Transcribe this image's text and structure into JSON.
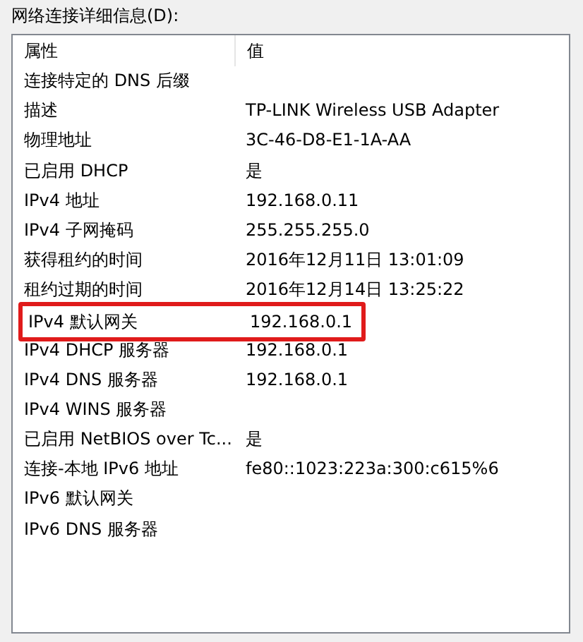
{
  "label": "网络连接详细信息(D):",
  "table": {
    "columns": [
      "属性",
      "值"
    ],
    "rows": [
      {
        "property": "连接特定的 DNS 后缀",
        "value": "",
        "highlighted": false
      },
      {
        "property": "描述",
        "value": "TP-LINK Wireless USB Adapter",
        "highlighted": false
      },
      {
        "property": "物理地址",
        "value": "3C-46-D8-E1-1A-AA",
        "highlighted": false
      },
      {
        "property": "已启用 DHCP",
        "value": "是",
        "highlighted": false
      },
      {
        "property": "IPv4 地址",
        "value": "192.168.0.11",
        "highlighted": false
      },
      {
        "property": "IPv4 子网掩码",
        "value": "255.255.255.0",
        "highlighted": false
      },
      {
        "property": "获得租约的时间",
        "value": "2016年12月11日 13:01:09",
        "highlighted": false
      },
      {
        "property": "租约过期的时间",
        "value": "2016年12月14日 13:25:22",
        "highlighted": false
      },
      {
        "property": "IPv4 默认网关",
        "value": "192.168.0.1",
        "highlighted": true
      },
      {
        "property": "IPv4 DHCP 服务器",
        "value": "192.168.0.1",
        "highlighted": false
      },
      {
        "property": "IPv4 DNS 服务器",
        "value": "192.168.0.1",
        "highlighted": false
      },
      {
        "property": "IPv4 WINS 服务器",
        "value": "",
        "highlighted": false
      },
      {
        "property": "已启用 NetBIOS over Tc...",
        "value": "是",
        "highlighted": false
      },
      {
        "property": "连接-本地 IPv6 地址",
        "value": "fe80::1023:223a:300:c615%6",
        "highlighted": false
      },
      {
        "property": "IPv6 默认网关",
        "value": "",
        "highlighted": false
      },
      {
        "property": "IPv6 DNS 服务器",
        "value": "",
        "highlighted": false
      }
    ]
  }
}
